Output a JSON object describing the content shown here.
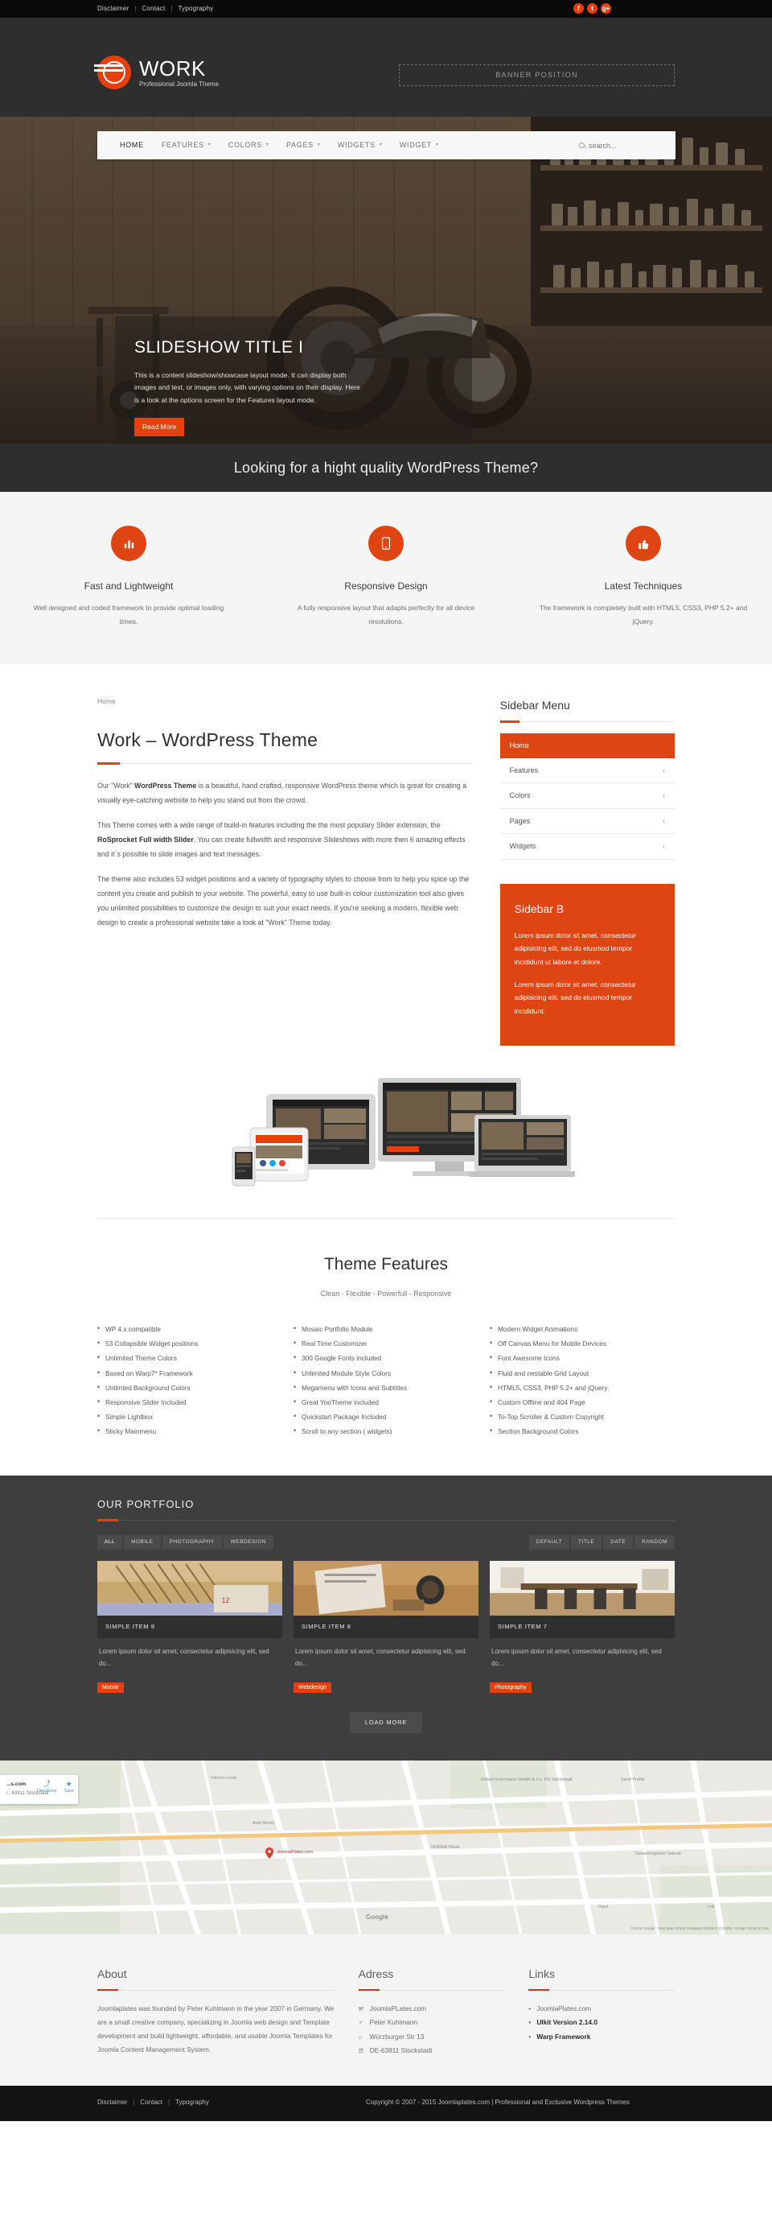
{
  "topbar": {
    "links": [
      "Disclaimer",
      "Contact",
      "Typography"
    ],
    "separator": "|",
    "social": [
      {
        "name": "facebook-icon",
        "glyph": "f"
      },
      {
        "name": "twitter-icon",
        "glyph": "t"
      },
      {
        "name": "googleplus-icon",
        "glyph": "g+"
      }
    ]
  },
  "header": {
    "logo_title": "WORK",
    "logo_subtitle": "Professional Joomla Theme",
    "banner_placeholder": "BANNER POSITION"
  },
  "nav": {
    "items": [
      {
        "label": "HOME",
        "has_caret": false,
        "active": true
      },
      {
        "label": "FEATURES",
        "has_caret": true,
        "active": false
      },
      {
        "label": "COLORS",
        "has_caret": true,
        "active": false
      },
      {
        "label": "PAGES",
        "has_caret": true,
        "active": false
      },
      {
        "label": "WIDGETS",
        "has_caret": true,
        "active": false
      },
      {
        "label": "WIDGET",
        "has_caret": true,
        "active": false
      }
    ],
    "search_placeholder": "search..."
  },
  "slideshow": {
    "title": "SLIDESHOW TITLE I",
    "text": "This is a content slideshow/showcase layout mode. It can display both images and text, or images only, with varying options on their display. Here is a look at the options screen for the Features layout mode.",
    "button": "Read More"
  },
  "cta": {
    "text": "Looking for a hight quality WordPress Theme?"
  },
  "features3": [
    {
      "icon": "bar-chart-icon",
      "title": "Fast and Lightweight",
      "desc": "Well designed and coded framework to provide optimal loading times."
    },
    {
      "icon": "mobile-device-icon",
      "title": "Responsive Design",
      "desc": "A fully responsive layout that adapts perfectly for all device resolutions."
    },
    {
      "icon": "thumbs-up-icon",
      "title": "Latest Techniques",
      "desc": "The framework is completely built with HTML5, CSS3, PHP 5.2+ and jQuery."
    }
  ],
  "content": {
    "breadcrumb": "Home",
    "title": "Work – WordPress Theme",
    "p1_pre": "Our \"Work\" ",
    "p1_strong": "WordPress Theme",
    "p1_post": " is a beautiful, hand crafted, responsive WordPress theme which is great for creating a visually eye-catching website to help you stand out from the crowd.",
    "p2_pre": "This Theme comes with a wide range of build-in features including the the most populary Slider extension, the ",
    "p2_strong": "RoSprocket Full width Slider",
    "p2_post": ". You can create fullwidth and responsive Slideshows with more then 6 amazing effects and it´s possible to slide images and text messages.",
    "p3": "The theme also includes 53 widget positions and a variety of typography styles to choose from to help you spice up the content you create and publish to your website. The powerful, easy to use built-in colour customization tool also gives you unlimited possibilities to customize the design to suit your exact needs. If you're seeking a modern, flexible web design to create a professional website take a look at \"Work\" Theme today."
  },
  "sidebar": {
    "menu_title": "Sidebar Menu",
    "items": [
      {
        "label": "Home",
        "active": true,
        "chevron": ""
      },
      {
        "label": "Features",
        "active": false,
        "chevron": "‹"
      },
      {
        "label": "Colors",
        "active": false,
        "chevron": "‹"
      },
      {
        "label": "Pages",
        "active": false,
        "chevron": "‹"
      },
      {
        "label": "Widgets",
        "active": false,
        "chevron": "‹"
      }
    ],
    "widget_b": {
      "title": "Sidebar B",
      "p1": "Lorem ipsum dolor sit amet, consectetur adipisicing elit, sed do eiusmod tempor incididunt ut labore et dolore.",
      "p2": "Lorem ipsum dolor sit amet, consectetur adipisicing elit, sed do eiusmod tempor incididunt."
    }
  },
  "theme_features": {
    "title": "Theme Features",
    "subtitle": "Clean - Flexible - Powerfull - Responsive",
    "columns": [
      [
        "WP 4.x compatible",
        "53 Collapsible Widget positions",
        "Unlimited Theme Colors",
        "Based on Warp7* Framework",
        "Unlimted Background Colors",
        "Responsive Slider Included",
        "Simple Lightbox",
        "Sticky Mainmenu"
      ],
      [
        "Mosaic Portfolio Module",
        "Real Time Customizer",
        "300 Google Fonts included",
        "Unlimited Module Style Colors",
        "Megamenu with Icons and Subtitles",
        "Great YooTheme          included",
        "Quickstart Package Included",
        "Scroll to any section ( widgets)"
      ],
      [
        "Modern Widget Animations",
        "Off Canvas Menu for Mobile Devices",
        "Font Awesome Icons",
        "Fluid and nestable Grid Layout",
        "HTML5, CSS3, PHP 5.2+ and jQuery.",
        "Custom Offline and 404 Page",
        "To-Top Scroller & Custom Copyright",
        "Section Background Colors"
      ]
    ]
  },
  "portfolio": {
    "heading": "OUR PORTFOLIO",
    "filters": [
      "ALL",
      "MOBILE",
      "PHOTOGRAPHY",
      "WEBDESIGN"
    ],
    "sorts": [
      "DEFAULT",
      "TITLE",
      "DATE",
      "RANDOM"
    ],
    "items": [
      {
        "title": "SIMPLE ITEM 9",
        "desc": "Lorem ipsum dolor sit amet, consectetur adipisicing elit, sed do...",
        "tag": "Mobile"
      },
      {
        "title": "SIMPLE ITEM 8",
        "desc": "Lorem ipsum dolor sit amet, consectetur adipisicing elit, sed do...",
        "tag": "Webdesign"
      },
      {
        "title": "SIMPLE ITEM 7",
        "desc": "Lorem ipsum dolor sit amet, consectetur adipisicing elit, sed do...",
        "tag": "Photography"
      }
    ],
    "load_more": "LOAD MORE"
  },
  "map": {
    "card_title": "...s.com",
    "card_address": "r., 63811 Stockstadt",
    "directions": "Directions",
    "save": "Save",
    "business_label": "JoomlaPlates.com",
    "watermark": "Google",
    "legal": "©2015 Google - Map data ©2015 GeoBasis-DE/BKG (©2009), Google     Terms of Use",
    "street_labels": [
      "Fitness Level",
      "Robert Kunzmann GmbH & Co. KG Stockstadt",
      "Sand Profile",
      "Auto Meiss",
      "NORMA Filiale",
      "Gewerbegebiet Ostend",
      "Input",
      "Lidl"
    ]
  },
  "footer": {
    "about": {
      "title": "About",
      "text": "Joomlaplates was founded by Peter Kuhlmann in the year 2007 in Germany. We are a small creative company, specializing in Joomla web design and Template development and build lightweight, affordable, and usable Joomla Templates for Joomla Content Management System."
    },
    "adress": {
      "title": "Adress",
      "items": [
        {
          "icon": "envelope-icon",
          "glyph": "✉",
          "label": "JoomlaPLates.com"
        },
        {
          "icon": "user-icon",
          "glyph": "♂",
          "label": "Peter Kuhlmann"
        },
        {
          "icon": "home-icon",
          "glyph": "⌂",
          "label": "Würzburger Str 13"
        },
        {
          "icon": "sitemap-icon",
          "glyph": "☴",
          "label": "DE-63811 Stockstadt"
        }
      ]
    },
    "links": {
      "title": "Links",
      "items": [
        {
          "label": "JoomlaPlates.com",
          "strong": false
        },
        {
          "label": "UIkit Version 2.14.0",
          "strong": true
        },
        {
          "label": "Warp Framework",
          "strong": true
        }
      ]
    }
  },
  "bottombar": {
    "links": [
      "Disclaimer",
      "Contact",
      "Typography"
    ],
    "separator": "|",
    "copyright": "Copyright © 2007 - 2015 Joomlaplates.com | Professional and Exclusive Wordpress Themes"
  },
  "colors": {
    "accent": "#e8400c",
    "accent_dark": "#de4512",
    "dark": "#2e2e2e",
    "darker": "#131313",
    "portfolio_bg": "#3e3e3e"
  }
}
